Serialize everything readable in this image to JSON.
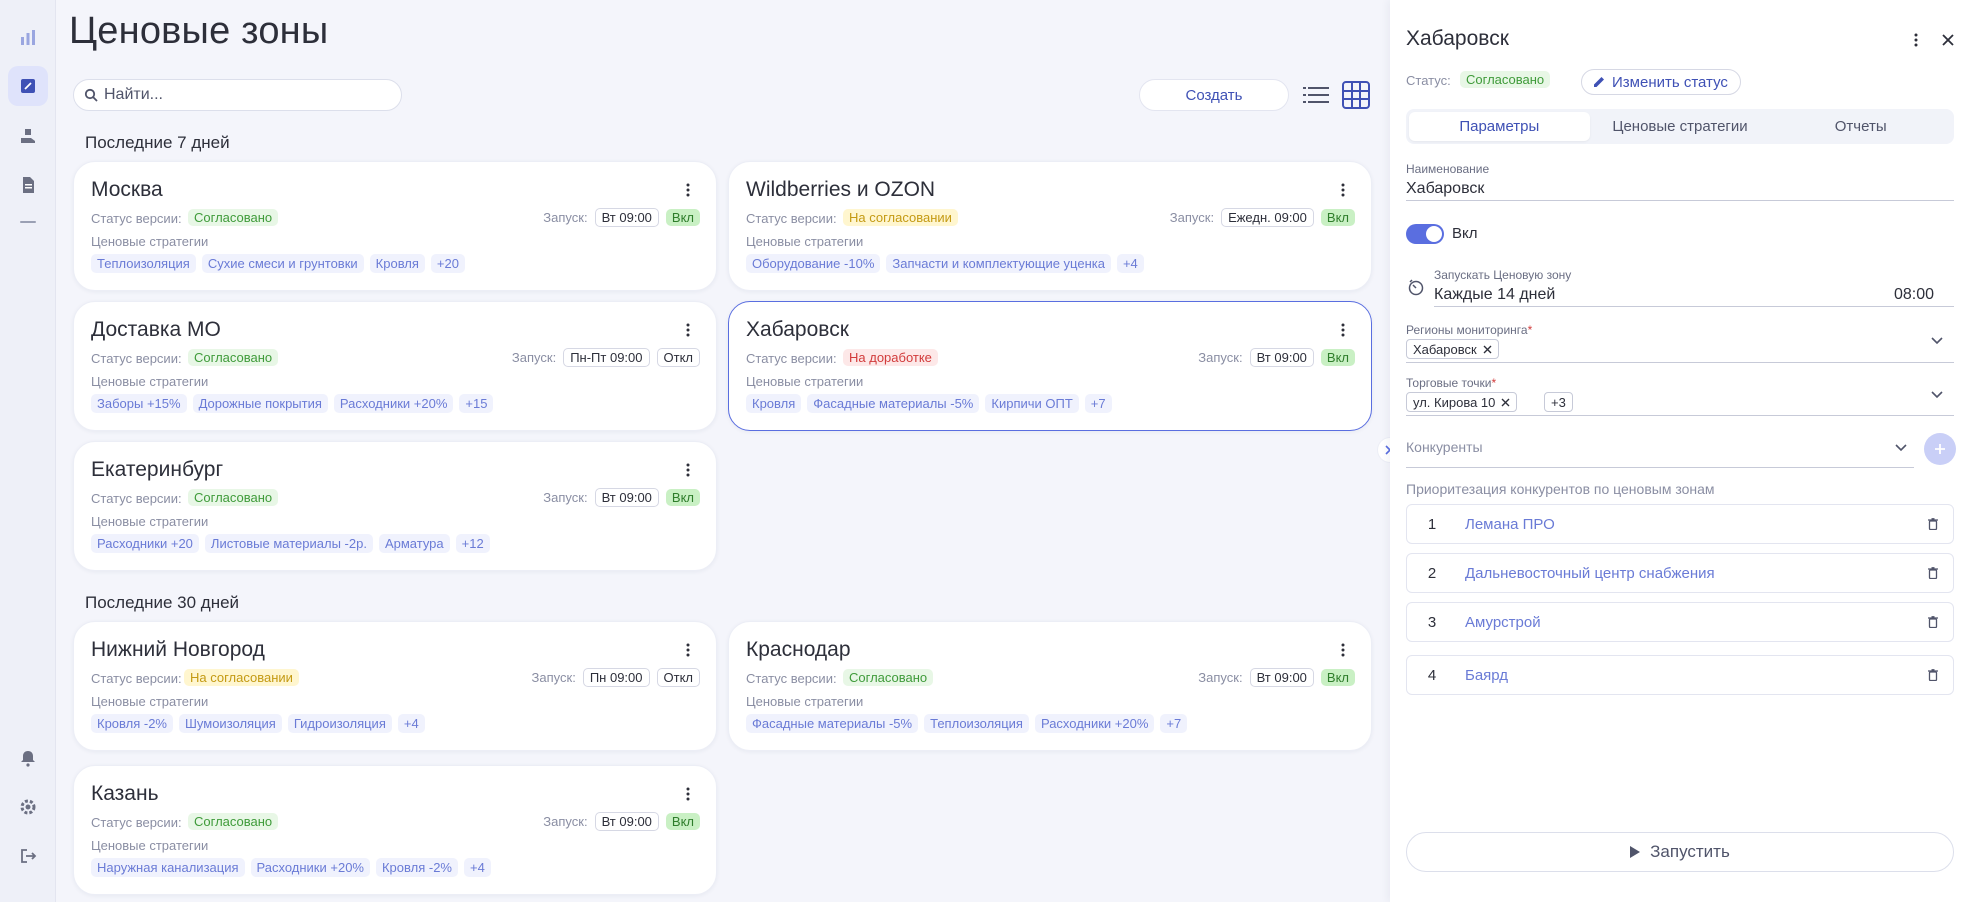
{
  "page": {
    "title": "Ценовые зоны"
  },
  "search": {
    "placeholder": "Найти..."
  },
  "toolbar": {
    "create_label": "Создать"
  },
  "labels": {
    "status": "Статус версии:",
    "launch": "Запуск:",
    "strategies": "Ценовые стратегии"
  },
  "sections": [
    {
      "title": "Последние 7 дней"
    },
    {
      "title": "Последние 30 дней"
    }
  ],
  "cards": [
    {
      "name": "Москва",
      "status": "Согласовано",
      "launch_time": "Вт 09:00",
      "state": "Вкл",
      "tags": [
        "Теплоизоляция",
        "Сухие смеси и грунтовки",
        "Кровля",
        "+20"
      ]
    },
    {
      "name": "Wildberries и OZON",
      "status": "На согласовании",
      "launch_time": "Ежедн. 09:00",
      "state": "Вкл",
      "tags": [
        "Оборудование -10%",
        "Запчасти и комплектующие уценка",
        "+4"
      ]
    },
    {
      "name": "Доставка МО",
      "status": "Согласовано",
      "launch_time": "Пн-Пт 09:00",
      "state": "Откл",
      "tags": [
        "Заборы +15%",
        "Дорожные покрытия",
        "Расходники +20%",
        "+15"
      ]
    },
    {
      "name": "Хабаровск",
      "status": "На доработке",
      "launch_time": "Вт 09:00",
      "state": "Вкл",
      "tags": [
        "Кровля",
        "Фасадные материалы -5%",
        "Кирпичи ОПТ",
        "+7"
      ]
    },
    {
      "name": "Екатеринбург",
      "status": "Согласовано",
      "launch_time": "Вт 09:00",
      "state": "Вкл",
      "tags": [
        "Расходники +20",
        "Листовые материалы -2р.",
        "Арматура",
        "+12"
      ]
    },
    {
      "name": "Нижний Новгород",
      "status": "На согласовании",
      "launch_time": "Пн 09:00",
      "state": "Откл",
      "tags": [
        "Кровля -2%",
        "Шумоизоляция",
        "Гидроизоляция",
        "+4"
      ]
    },
    {
      "name": "Краснодар",
      "status": "Согласовано",
      "launch_time": "Вт 09:00",
      "state": "Вкл",
      "tags": [
        "Фасадные материалы -5%",
        "Теплоизоляция",
        "Расходники +20%",
        "+7"
      ]
    },
    {
      "name": "Казань",
      "status": "Согласовано",
      "launch_time": "Вт 09:00",
      "state": "Вкл",
      "tags": [
        "Наружная канализация",
        "Расходники +20%",
        "Кровля -2%",
        "+4"
      ]
    }
  ],
  "panel": {
    "title": "Хабаровск",
    "status_label": "Статус:",
    "status": "Согласовано",
    "change_status": "Изменить статус",
    "tabs": [
      "Параметры",
      "Ценовые стратегии",
      "Отчеты"
    ],
    "name_label": "Наименование",
    "name_value": "Хабаровск",
    "toggle_label": "Вкл",
    "schedule_label": "Запускать Ценовую зону",
    "schedule_value": "Каждые 14 дней",
    "schedule_time": "08:00",
    "regions_label": "Регионы мониторинга",
    "regions_chip": "Хабаровск",
    "points_label": "Торговые точки",
    "points_chip": "ул. Кирова 10",
    "points_more": "+3",
    "competitors_label": "Конкуренты",
    "priority_label": "Приоритезация конкурентов по ценовым зонам",
    "competitors": [
      {
        "num": "1",
        "name": "Лемана ПРО"
      },
      {
        "num": "2",
        "name": "Дальневосточный центр снабжения"
      },
      {
        "num": "3",
        "name": "Амурстрой"
      },
      {
        "num": "4",
        "name": "Баярд"
      }
    ],
    "run_label": "Запустить"
  },
  "colors": {
    "accent": "#3f51b5",
    "on": "#c9f0c4",
    "approved": "#3f9b3a",
    "pending": "#c49a13",
    "rework": "#d23b3b"
  }
}
